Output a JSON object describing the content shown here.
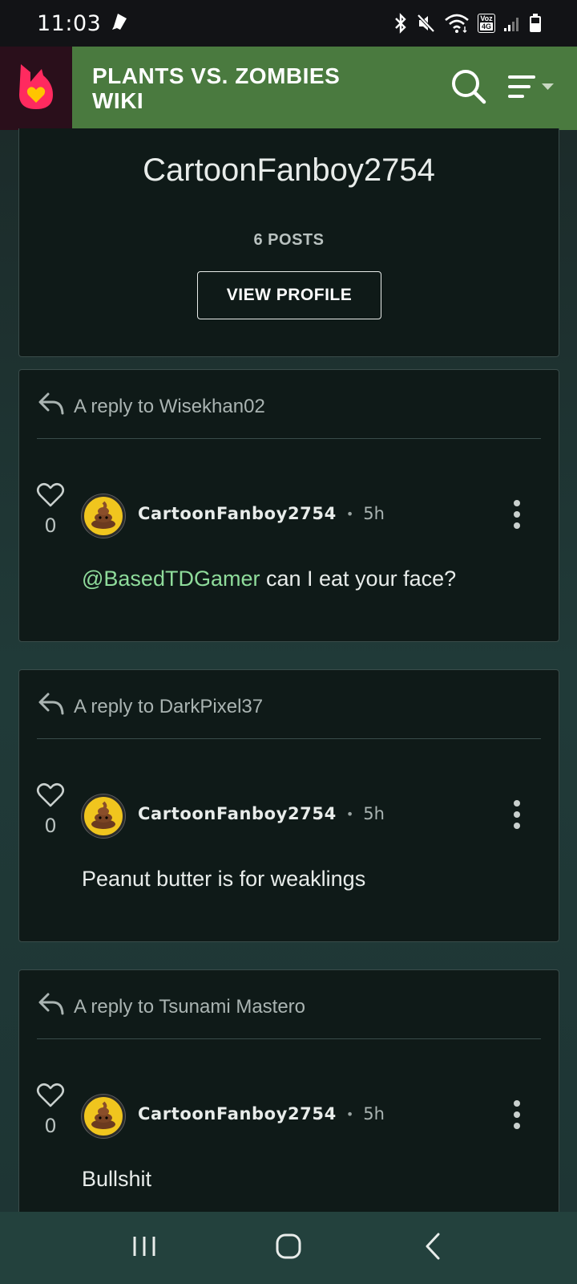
{
  "status_bar": {
    "time": "11:03",
    "icons": [
      "notification-icon",
      "bluetooth-icon",
      "mute-icon",
      "wifi-icon",
      "volte-icon",
      "signal-icon",
      "battery-icon"
    ],
    "volte_top": "Voz",
    "volte_bottom": "4G"
  },
  "header": {
    "brand_icon": "fandom-logo-icon",
    "wiki_title": "PLANTS VS. ZOMBIES WIKI",
    "search_icon": "search-icon",
    "menu_icon": "menu-icon",
    "colors": {
      "wiki_bar": "#4a7a3f",
      "logo_bg": "#2a0f1b",
      "logo_flame": "#ff2a5f",
      "logo_heart": "#ffc500"
    }
  },
  "profile": {
    "username": "CartoonFanboy2754",
    "posts": "6 POSTS",
    "view_profile_label": "VIEW PROFILE"
  },
  "replies": [
    {
      "reply_to": "A reply to Wisekhan02",
      "likes": "0",
      "author": "CartoonFanboy2754",
      "dot": "•",
      "time": "5h",
      "mention": "@BasedTDGamer",
      "text": " can I eat your face?"
    },
    {
      "reply_to": "A reply to DarkPixel37",
      "likes": "0",
      "author": "CartoonFanboy2754",
      "dot": "•",
      "time": "5h",
      "mention": "",
      "text": "Peanut butter is for weaklings"
    },
    {
      "reply_to": "A reply to Tsunami Mastero",
      "likes": "0",
      "author": "CartoonFanboy2754",
      "dot": "•",
      "time": "5h",
      "mention": "",
      "text": "Bullshit"
    }
  ],
  "nav": {
    "recents_icon": "recents-icon",
    "home_icon": "home-icon",
    "back_icon": "back-icon"
  },
  "colors": {
    "mention": "#8fdc9b",
    "card_bg": "#0f1a18",
    "nav_bar": "#23413d"
  }
}
